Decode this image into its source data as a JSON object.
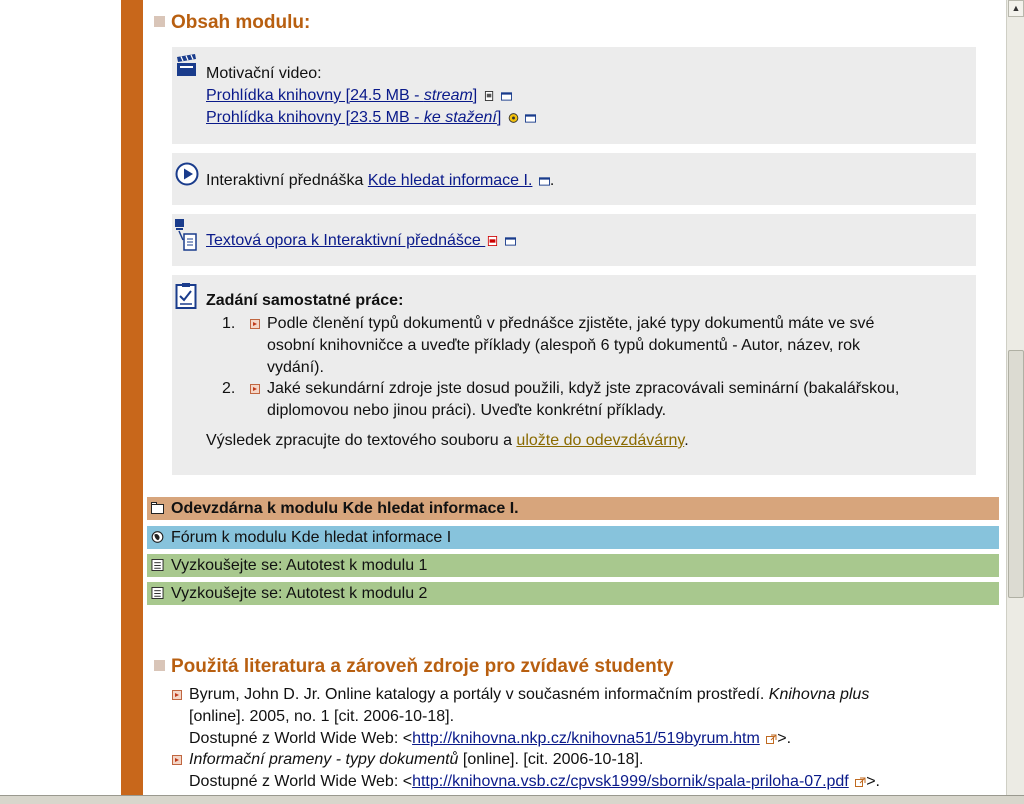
{
  "sections": {
    "content_title": "Obsah modulu:",
    "literature_title": "Použitá literatura a zároveň zdroje pro zvídavé studenty"
  },
  "video": {
    "label": "Motivační video:",
    "link1": "Prohlídka knihovny [24.5 MB - ",
    "link1_em": "stream",
    "link1_end": "]",
    "link2": "Prohlídka knihovny [23.5 MB - ",
    "link2_em": "ke stažení",
    "link2_end": "]"
  },
  "lecture": {
    "prefix": "Interaktivní přednáška ",
    "link": "Kde hledat informace I.",
    "suffix": "."
  },
  "text_support": {
    "link": "Textová opora k Interaktivní přednášce "
  },
  "assignment": {
    "title": "Zadání samostatné práce:",
    "item1_num": "1.",
    "item1_l1": "Podle členění typů dokumentů v přednášce zjistěte, jaké typy dokumentů máte ve své",
    "item1_l2": "osobní knihovničce a uveďte příklady (alespoň 6 typů dokumentů - Autor, název, rok",
    "item1_l3": "vydání).",
    "item2_num": "2.",
    "item2_l1": "Jaké sekundární zdroje jste dosud použili, když jste zpracovávali seminární (bakalářskou,",
    "item2_l2": "diplomovou nebo jinou práci). Uveďte konkrétní příklady.",
    "result_prefix": "Výsledek zpracujte do textového souboru a ",
    "result_link": "uložte do odevzdávárny",
    "result_suffix": "."
  },
  "bars": [
    {
      "label": "Odevzdárna k modulu Kde hledat informace I.",
      "color": "#d7a57c"
    },
    {
      "label": "Fórum k modulu Kde hledat informace I",
      "color": "#87c3dc"
    },
    {
      "label": "Vyzkoušejte se: Autotest k modulu 1",
      "color": "#a8c88e"
    },
    {
      "label": "Vyzkoušejte se: Autotest k modulu 2",
      "color": "#a8c88e"
    }
  ],
  "literature": {
    "ref1_l1a": "Byrum, John D. Jr. Online katalogy a portály v současném informačním prostředí. ",
    "ref1_l1b": "Knihovna plus",
    "ref1_l2": "[online]. 2005, no. 1 [cit. 2006-10-18].",
    "ref1_l3a": "Dostupné z World Wide Web: <",
    "ref1_url": "http://knihovna.nkp.cz/knihovna51/519byrum.htm",
    "ref1_l3c": ">.",
    "ref2_l1a": "Informační prameny - typy dokumentů",
    "ref2_l1b": " [online]. [cit. 2006-10-18].",
    "ref2_l2a": "Dostupné z World Wide Web: <",
    "ref2_url": "http://knihovna.vsb.cz/cpvsk1999/sbornik/spala-priloha-07.pdf",
    "ref2_l2c": ">."
  },
  "colors": {
    "accent_orange": "#c8671b",
    "title_color": "#b85f10",
    "link_color": "#0a1a8a",
    "box_bg": "#ececec"
  }
}
